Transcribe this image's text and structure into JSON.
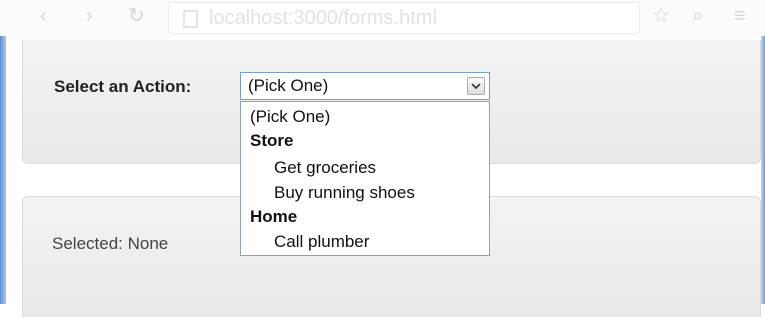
{
  "browser": {
    "url": "localhost:3000/forms.html",
    "icons": [
      "back-icon",
      "forward-icon",
      "reload-icon",
      "star-icon",
      "search-icon",
      "menu-icon"
    ]
  },
  "form": {
    "label": "Select an Action:",
    "selected_value": "(Pick One)",
    "options": [
      {
        "type": "option",
        "label": "(Pick One)"
      },
      {
        "type": "group",
        "label": "Store"
      },
      {
        "type": "option",
        "label": "Get groceries",
        "group": "Store"
      },
      {
        "type": "option",
        "label": "Buy running shoes",
        "group": "Store"
      },
      {
        "type": "group",
        "label": "Home"
      },
      {
        "type": "option",
        "label": "Call plumber",
        "group": "Home"
      }
    ]
  },
  "result": {
    "text": "Selected: None"
  },
  "colors": {
    "panel": "#eeeeee",
    "select_border": "#7a9cc6",
    "window_edge": "#5b8fd6"
  }
}
